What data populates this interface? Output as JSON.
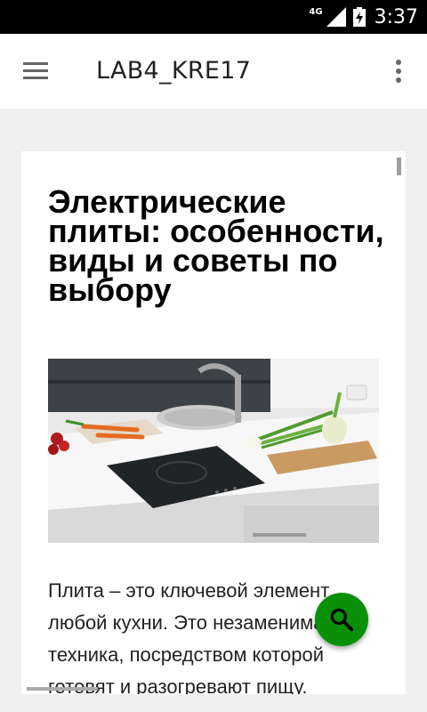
{
  "status_bar": {
    "network": "4G",
    "time": "3:37",
    "icons": [
      "signal-icon",
      "battery-charging-icon"
    ]
  },
  "app_bar": {
    "title": "LAB4_KRE17",
    "icons": [
      "menu-icon",
      "more-vert-icon"
    ]
  },
  "article": {
    "title": "Электрические плиты: особенности, виды и советы по выбору",
    "image_alt": "kitchen-cooktop-image",
    "body_lines": [
      "Плита – это ключевой элемент",
      "любой кухни. Это незаменимая",
      "техника, посредством которой",
      "готовят и разогревают пищу."
    ]
  },
  "fab": {
    "icon": "search-icon",
    "color": "#0a8f08"
  }
}
